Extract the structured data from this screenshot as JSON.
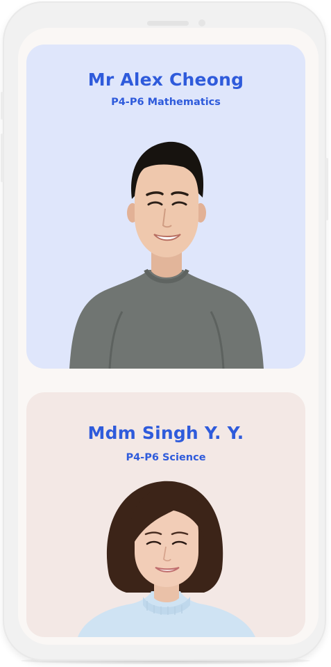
{
  "colors": {
    "accent": "#2f5bdb",
    "card_1_bg": "#dfe6fb",
    "card_2_bg": "#f3e8e5",
    "screen_bg": "#faf7f5",
    "phone_frame": "#f1f1f1"
  },
  "teachers": [
    {
      "name": "Mr Alex Cheong",
      "subject": "P4-P6 Mathematics",
      "shirt_color": "#707572",
      "hair_color": "#17130f"
    },
    {
      "name": "Mdm Singh Y. Y.",
      "subject": "P4-P6 Science",
      "shirt_color": "#cfe3f3",
      "hair_color": "#3c2418"
    }
  ]
}
